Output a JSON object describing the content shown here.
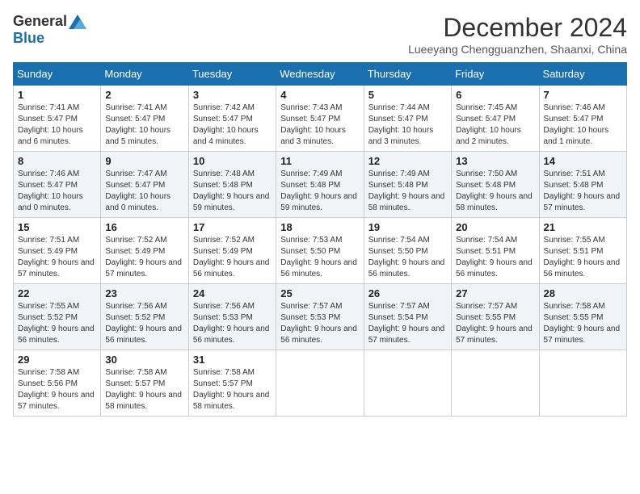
{
  "logo": {
    "general": "General",
    "blue": "Blue"
  },
  "title": "December 2024",
  "location": "Lueeyang Chengguanzhen, Shaanxi, China",
  "days_of_week": [
    "Sunday",
    "Monday",
    "Tuesday",
    "Wednesday",
    "Thursday",
    "Friday",
    "Saturday"
  ],
  "weeks": [
    [
      {
        "day": "1",
        "sunrise": "7:41 AM",
        "sunset": "5:47 PM",
        "daylight": "10 hours and 6 minutes"
      },
      {
        "day": "2",
        "sunrise": "7:41 AM",
        "sunset": "5:47 PM",
        "daylight": "10 hours and 5 minutes"
      },
      {
        "day": "3",
        "sunrise": "7:42 AM",
        "sunset": "5:47 PM",
        "daylight": "10 hours and 4 minutes"
      },
      {
        "day": "4",
        "sunrise": "7:43 AM",
        "sunset": "5:47 PM",
        "daylight": "10 hours and 3 minutes"
      },
      {
        "day": "5",
        "sunrise": "7:44 AM",
        "sunset": "5:47 PM",
        "daylight": "10 hours and 3 minutes"
      },
      {
        "day": "6",
        "sunrise": "7:45 AM",
        "sunset": "5:47 PM",
        "daylight": "10 hours and 2 minutes"
      },
      {
        "day": "7",
        "sunrise": "7:46 AM",
        "sunset": "5:47 PM",
        "daylight": "10 hours and 1 minute"
      }
    ],
    [
      {
        "day": "8",
        "sunrise": "7:46 AM",
        "sunset": "5:47 PM",
        "daylight": "10 hours and 0 minutes"
      },
      {
        "day": "9",
        "sunrise": "7:47 AM",
        "sunset": "5:47 PM",
        "daylight": "10 hours and 0 minutes"
      },
      {
        "day": "10",
        "sunrise": "7:48 AM",
        "sunset": "5:48 PM",
        "daylight": "9 hours and 59 minutes"
      },
      {
        "day": "11",
        "sunrise": "7:49 AM",
        "sunset": "5:48 PM",
        "daylight": "9 hours and 59 minutes"
      },
      {
        "day": "12",
        "sunrise": "7:49 AM",
        "sunset": "5:48 PM",
        "daylight": "9 hours and 58 minutes"
      },
      {
        "day": "13",
        "sunrise": "7:50 AM",
        "sunset": "5:48 PM",
        "daylight": "9 hours and 58 minutes"
      },
      {
        "day": "14",
        "sunrise": "7:51 AM",
        "sunset": "5:48 PM",
        "daylight": "9 hours and 57 minutes"
      }
    ],
    [
      {
        "day": "15",
        "sunrise": "7:51 AM",
        "sunset": "5:49 PM",
        "daylight": "9 hours and 57 minutes"
      },
      {
        "day": "16",
        "sunrise": "7:52 AM",
        "sunset": "5:49 PM",
        "daylight": "9 hours and 57 minutes"
      },
      {
        "day": "17",
        "sunrise": "7:52 AM",
        "sunset": "5:49 PM",
        "daylight": "9 hours and 56 minutes"
      },
      {
        "day": "18",
        "sunrise": "7:53 AM",
        "sunset": "5:50 PM",
        "daylight": "9 hours and 56 minutes"
      },
      {
        "day": "19",
        "sunrise": "7:54 AM",
        "sunset": "5:50 PM",
        "daylight": "9 hours and 56 minutes"
      },
      {
        "day": "20",
        "sunrise": "7:54 AM",
        "sunset": "5:51 PM",
        "daylight": "9 hours and 56 minutes"
      },
      {
        "day": "21",
        "sunrise": "7:55 AM",
        "sunset": "5:51 PM",
        "daylight": "9 hours and 56 minutes"
      }
    ],
    [
      {
        "day": "22",
        "sunrise": "7:55 AM",
        "sunset": "5:52 PM",
        "daylight": "9 hours and 56 minutes"
      },
      {
        "day": "23",
        "sunrise": "7:56 AM",
        "sunset": "5:52 PM",
        "daylight": "9 hours and 56 minutes"
      },
      {
        "day": "24",
        "sunrise": "7:56 AM",
        "sunset": "5:53 PM",
        "daylight": "9 hours and 56 minutes"
      },
      {
        "day": "25",
        "sunrise": "7:57 AM",
        "sunset": "5:53 PM",
        "daylight": "9 hours and 56 minutes"
      },
      {
        "day": "26",
        "sunrise": "7:57 AM",
        "sunset": "5:54 PM",
        "daylight": "9 hours and 57 minutes"
      },
      {
        "day": "27",
        "sunrise": "7:57 AM",
        "sunset": "5:55 PM",
        "daylight": "9 hours and 57 minutes"
      },
      {
        "day": "28",
        "sunrise": "7:58 AM",
        "sunset": "5:55 PM",
        "daylight": "9 hours and 57 minutes"
      }
    ],
    [
      {
        "day": "29",
        "sunrise": "7:58 AM",
        "sunset": "5:56 PM",
        "daylight": "9 hours and 57 minutes"
      },
      {
        "day": "30",
        "sunrise": "7:58 AM",
        "sunset": "5:57 PM",
        "daylight": "9 hours and 58 minutes"
      },
      {
        "day": "31",
        "sunrise": "7:58 AM",
        "sunset": "5:57 PM",
        "daylight": "9 hours and 58 minutes"
      },
      null,
      null,
      null,
      null
    ]
  ],
  "labels": {
    "sunrise": "Sunrise:",
    "sunset": "Sunset:",
    "daylight": "Daylight:"
  }
}
